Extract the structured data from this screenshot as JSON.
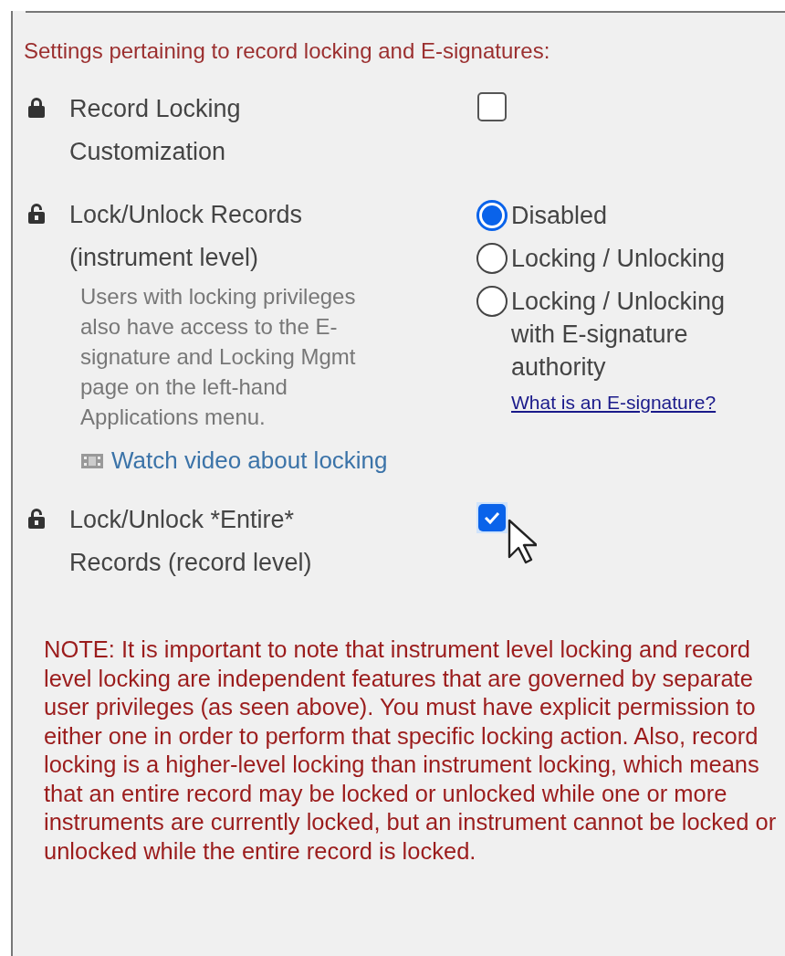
{
  "heading": "Settings pertaining to record locking and E-signatures:",
  "settings": [
    {
      "kind": "checkbox",
      "label": "Record Locking Customization",
      "checked": false,
      "cursor": false
    },
    {
      "kind": "radio",
      "label": "Lock/Unlock Records (instrument level)",
      "description": "Users with locking privileges also have access to the E-signature and Locking Mgmt page on the left-hand Applications menu.",
      "video_link": "Watch video about locking",
      "options": [
        {
          "label": "Disabled",
          "selected": true
        },
        {
          "label": "Locking / Unlocking",
          "selected": false
        },
        {
          "label": "Locking / Unlocking with E-signature authority",
          "selected": false
        }
      ],
      "help_link": "What is an E-signature?"
    },
    {
      "kind": "checkbox",
      "label": "Lock/Unlock *Entire* Records (record level)",
      "checked": true,
      "cursor": true
    }
  ],
  "note": "NOTE: It is important to note that instrument level locking and record level locking are independent features that are governed by separate user privileges (as seen above). You must have explicit permission to either one in order to perform that specific locking action. Also, record locking is a higher-level locking than instrument locking, which means that an entire record may be locked or unlocked while one or more instruments are currently locked, but an instrument cannot be locked or unlocked while the entire record is locked."
}
